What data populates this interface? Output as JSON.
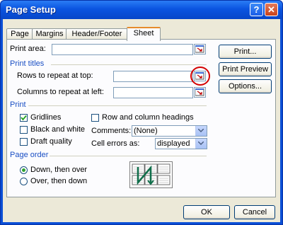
{
  "window": {
    "title": "Page Setup",
    "help_glyph": "?",
    "close_glyph": "✕"
  },
  "tabs": [
    {
      "label": "Page"
    },
    {
      "label": "Margins"
    },
    {
      "label": "Header/Footer"
    },
    {
      "label": "Sheet",
      "active": true
    }
  ],
  "sheet": {
    "print_area_label": "Print area:",
    "print_area_value": "",
    "print_titles_section": "Print titles",
    "rows_repeat_label": "Rows to repeat at top:",
    "rows_repeat_value": "",
    "cols_repeat_label": "Columns to repeat at left:",
    "cols_repeat_value": "",
    "print_section": "Print",
    "gridlines_label": "Gridlines",
    "gridlines_checked": true,
    "black_white_label": "Black and white",
    "black_white_checked": false,
    "draft_quality_label": "Draft quality",
    "draft_quality_checked": false,
    "row_col_headings_label": "Row and column headings",
    "row_col_headings_checked": false,
    "comments_label": "Comments:",
    "comments_value": "(None)",
    "cell_errors_label": "Cell errors as:",
    "cell_errors_value": "displayed",
    "page_order_section": "Page order",
    "down_then_over_label": "Down, then over",
    "down_then_over_selected": true,
    "over_then_down_label": "Over, then down",
    "over_then_down_selected": false
  },
  "side_buttons": {
    "print": "Print...",
    "print_preview": "Print Preview",
    "options": "Options..."
  },
  "footer": {
    "ok": "OK",
    "cancel": "Cancel"
  },
  "colors": {
    "highlight_circle": "#d40000",
    "section_text": "#1a4fc4",
    "title_bar": "#0a54e0"
  }
}
